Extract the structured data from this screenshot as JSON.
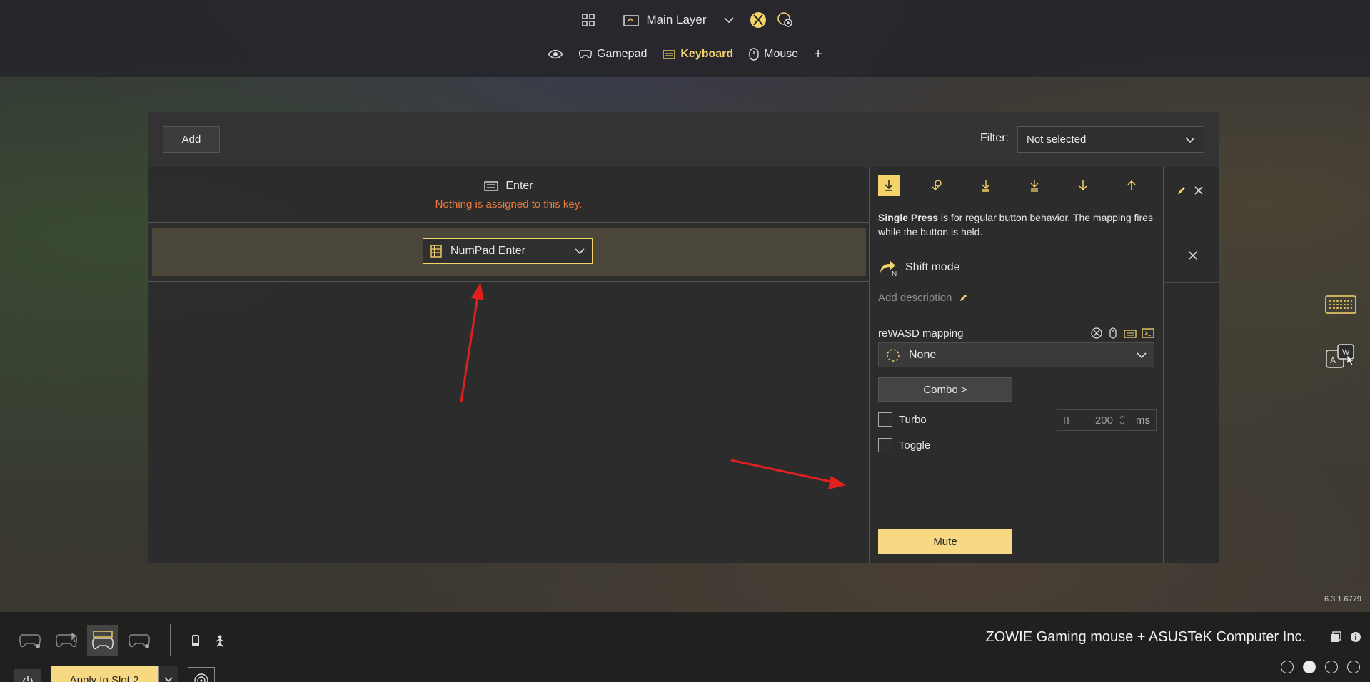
{
  "top": {
    "layer": "Main Layer",
    "tabs": [
      {
        "label": "Gamepad",
        "active": false
      },
      {
        "label": "Keyboard",
        "active": true
      },
      {
        "label": "Mouse",
        "active": false
      }
    ],
    "add_tab": "+"
  },
  "toolbar": {
    "add_label": "Add",
    "filter_label": "Filter:",
    "filter_value": "Not selected"
  },
  "mapping": {
    "key_name": "Enter",
    "warning": "Nothing is assigned to this key.",
    "selected_key": "NumPad Enter"
  },
  "panel": {
    "mode_bold": "Single Press",
    "mode_desc": " is for regular button behavior. The mapping fires while the button is held.",
    "shift_mode": "Shift mode",
    "add_description": "Add description",
    "rewasd_label": "reWASD mapping",
    "rewasd_value": "None",
    "combo_label": "Combo >",
    "turbo_label": "Turbo",
    "toggle_label": "Toggle",
    "turbo_value": "200",
    "turbo_unit": "ms",
    "mute_label": "Mute"
  },
  "status": {
    "version": "6.3.1.6779",
    "device_name": "ZOWIE Gaming mouse + ASUSTeK Computer Inc.",
    "apply_label": "Apply to Slot 2",
    "active_slot": 2
  },
  "colors": {
    "accent": "#f5d36b",
    "warning": "#f07a3c",
    "annotation": "#e02020"
  }
}
